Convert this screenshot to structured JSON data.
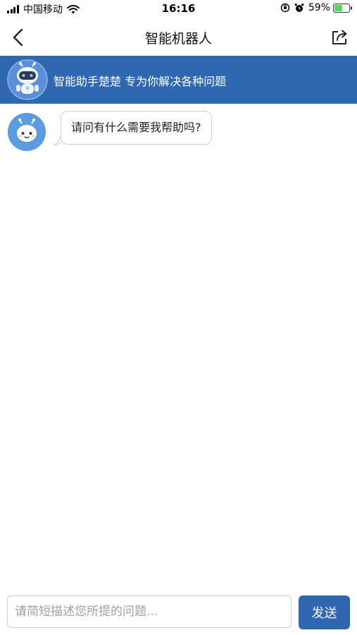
{
  "status_bar": {
    "carrier": "中国移动",
    "time": "16:16",
    "battery_percent": "59%",
    "battery_level": 0.59,
    "icons": [
      "signal-icon",
      "wifi-icon",
      "rotation-lock-icon",
      "alarm-icon",
      "battery-icon"
    ]
  },
  "nav": {
    "title": "智能机器人",
    "back_icon": "chevron-left-icon",
    "share_icon": "share-icon"
  },
  "banner": {
    "text": "智能助手楚楚 专为你解决各种问题",
    "background": "#2f67b1"
  },
  "messages": [
    {
      "from": "bot",
      "text": "请问有什么需要我帮助吗?"
    }
  ],
  "input": {
    "placeholder": "请简短描述您所提的问题...",
    "value": ""
  },
  "send": {
    "label": "发送",
    "color": "#2f67b1"
  }
}
